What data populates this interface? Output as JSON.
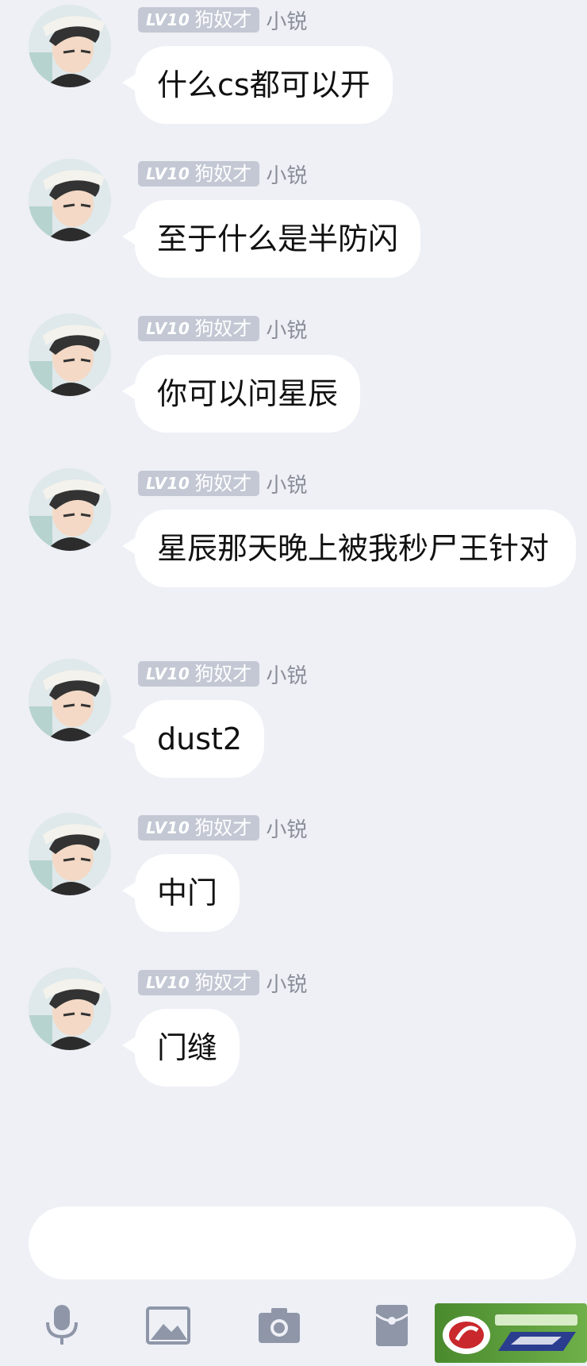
{
  "messages": [
    {
      "level": "LV10",
      "title": "狗奴才",
      "sender": "小锐",
      "text": "什么cs都可以开"
    },
    {
      "level": "LV10",
      "title": "狗奴才",
      "sender": "小锐",
      "text": "至于什么是半防闪"
    },
    {
      "level": "LV10",
      "title": "狗奴才",
      "sender": "小锐",
      "text": "你可以问星辰"
    },
    {
      "level": "LV10",
      "title": "狗奴才",
      "sender": "小锐",
      "text": "星辰那天晚上被我秒尸王针对"
    },
    {
      "level": "LV10",
      "title": "狗奴才",
      "sender": "小锐",
      "text": "dust2"
    },
    {
      "level": "LV10",
      "title": "狗奴才",
      "sender": "小锐",
      "text": "中门"
    },
    {
      "level": "LV10",
      "title": "狗奴才",
      "sender": "小锐",
      "text": "门缝"
    }
  ],
  "input": {
    "value": ""
  },
  "toolbar": {
    "icons": [
      "microphone-icon",
      "image-icon",
      "camera-icon",
      "red-packet-icon",
      "emoji-icon"
    ]
  },
  "colors": {
    "background": "#eef0f6",
    "bubble": "#ffffff",
    "badge": "#c3c8d4",
    "sender": "#8a8e99",
    "icon": "#8e96a8"
  }
}
